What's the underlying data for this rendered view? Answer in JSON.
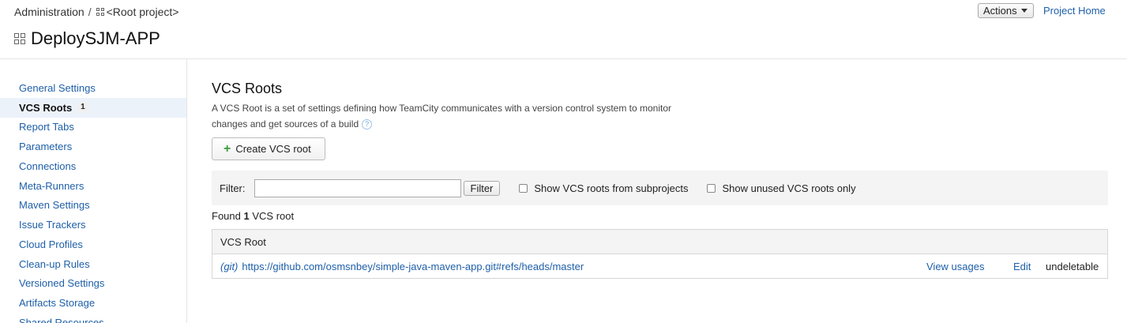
{
  "header": {
    "breadcrumb": {
      "admin": "Administration",
      "separator": "/",
      "root_project": "<Root project>"
    },
    "title": "DeploySJM-APP",
    "actions_label": "Actions",
    "project_home_label": "Project Home",
    "icons": {
      "project": "project-grid-icon",
      "actions_caret": "caret-down-icon"
    }
  },
  "sidebar": {
    "items": [
      {
        "label": "General Settings"
      },
      {
        "label": "VCS Roots",
        "count": "1",
        "active": true
      },
      {
        "label": "Report Tabs"
      },
      {
        "label": "Parameters"
      },
      {
        "label": "Connections"
      },
      {
        "label": "Meta-Runners"
      },
      {
        "label": "Maven Settings"
      },
      {
        "label": "Issue Trackers"
      },
      {
        "label": "Cloud Profiles"
      },
      {
        "label": "Clean-up Rules"
      },
      {
        "label": "Versioned Settings"
      },
      {
        "label": "Artifacts Storage"
      },
      {
        "label": "Shared Resources"
      }
    ]
  },
  "main": {
    "heading": "VCS Roots",
    "description_line1": "A VCS Root is a set of settings defining how TeamCity communicates with a version control system to monitor",
    "description_line2": "changes and get sources of a build",
    "help_glyph": "?",
    "create_button_label": "Create VCS root",
    "create_button_glyph": "+",
    "filter": {
      "label": "Filter:",
      "value": "",
      "button_label": "Filter",
      "show_subprojects_label": "Show VCS roots from subprojects",
      "show_subprojects_checked": false,
      "show_unused_label": "Show unused VCS roots only",
      "show_unused_checked": false
    },
    "found": {
      "prefix": "Found",
      "count": "1",
      "suffix": "VCS root"
    },
    "table": {
      "header": "VCS Root",
      "rows": [
        {
          "type": "(git)",
          "url": "https://github.com/osmsnbey/simple-java-maven-app.git#refs/heads/master",
          "view_usages": "View usages",
          "edit": "Edit",
          "status": "undeletable"
        }
      ]
    }
  },
  "colors": {
    "link": "#1e5fa8",
    "active_item_bg": "#ecf2fa",
    "filter_bar_bg": "#f4f4f4",
    "plus": "#3f9a3f"
  }
}
